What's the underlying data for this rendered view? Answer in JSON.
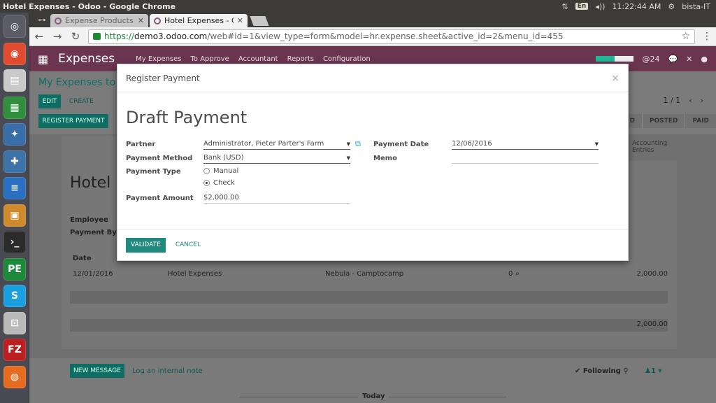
{
  "os": {
    "window_title": "Hotel Expenses - Odoo - Google Chrome",
    "keyboard": "En",
    "clock": "11:22:44 AM",
    "user": "bista-IT"
  },
  "launcher": {
    "items": [
      {
        "name": "ubuntu-dash-icon",
        "glyph": "◎",
        "color": "#5c5c66"
      },
      {
        "name": "chrome-icon",
        "glyph": "◉",
        "color": "#e04b2f"
      },
      {
        "name": "files-icon",
        "glyph": "▤",
        "color": "#c9c9c9"
      },
      {
        "name": "spreadsheet-icon",
        "glyph": "▦",
        "color": "#2f8f3b"
      },
      {
        "name": "postgresql-icon",
        "glyph": "✦",
        "color": "#3a6ea8"
      },
      {
        "name": "python-icon",
        "glyph": "✚",
        "color": "#3d73a8"
      },
      {
        "name": "writer-icon",
        "glyph": "≡",
        "color": "#2a6fc1"
      },
      {
        "name": "impress-icon",
        "glyph": "▣",
        "color": "#d08a2e"
      },
      {
        "name": "terminal-icon",
        "glyph": "›_",
        "color": "#2b2b2b"
      },
      {
        "name": "pycharm-icon",
        "glyph": "PE",
        "color": "#1d8a3a"
      },
      {
        "name": "skype-icon",
        "glyph": "S",
        "color": "#1aa0e0"
      },
      {
        "name": "store-icon",
        "glyph": "⊡",
        "color": "#b9b9b9"
      },
      {
        "name": "filezilla-icon",
        "glyph": "FZ",
        "color": "#bb2020"
      },
      {
        "name": "firefox-icon",
        "glyph": "◍",
        "color": "#e66a1f"
      }
    ]
  },
  "browser": {
    "tabs": [
      {
        "label": "Expense Products - ",
        "active": false
      },
      {
        "label": "Hotel Expenses - Od",
        "active": true
      }
    ],
    "url_secure": "https://",
    "url_host": "demo3.odoo.com",
    "url_path": "/web#id=1&view_type=form&model=hr.expense.sheet&active_id=2&menu_id=455"
  },
  "odoo": {
    "app_name": "Expenses",
    "menus": [
      "My Expenses",
      "To Approve",
      "Accountant",
      "Reports",
      "Configuration"
    ],
    "progress_fraction": 0.5,
    "messages_count": "24",
    "breadcrumb": "My Expenses to Su",
    "edit_label": "EDIT",
    "create_label": "CREATE",
    "pager": "1 / 1",
    "register_payment_label": "REGISTER PAYMENT",
    "statuses": [
      "D",
      "POSTED",
      "PAID"
    ],
    "smart_button": "Accounting Entries",
    "sheet_title": "Hotel",
    "employee_label": "Employee",
    "payment_by_label": "Payment By",
    "date_header": "Date",
    "line": {
      "date": "12/01/2016",
      "description": "Hotel Expenses",
      "analytic": "Nebula - Camptocamp",
      "attachments": "0",
      "total": "2,000.00"
    },
    "grand_total": "2,000.00",
    "new_message_label": "NEW MESSAGE",
    "log_note_label": "Log an internal note",
    "following_label": "✔ Following",
    "followers_label": "1",
    "today_label": "Today"
  },
  "modal": {
    "header": "Register Payment",
    "title": "Draft Payment",
    "partner_label": "Partner",
    "partner_value": "Administrator, Pieter Parter's Farm",
    "payment_method_label": "Payment Method",
    "payment_method_value": "Bank (USD)",
    "payment_type_label": "Payment Type",
    "payment_type_options": [
      "Manual",
      "Check"
    ],
    "payment_type_selected": "Check",
    "payment_amount_label": "Payment Amount",
    "payment_amount_value": "$2,000.00",
    "payment_date_label": "Payment Date",
    "payment_date_value": "12/06/2016",
    "memo_label": "Memo",
    "memo_value": "",
    "validate_label": "VALIDATE",
    "cancel_label": "CANCEL"
  },
  "colors": {
    "odoo_brand": "#875a7b",
    "primary_button": "#21897e"
  }
}
